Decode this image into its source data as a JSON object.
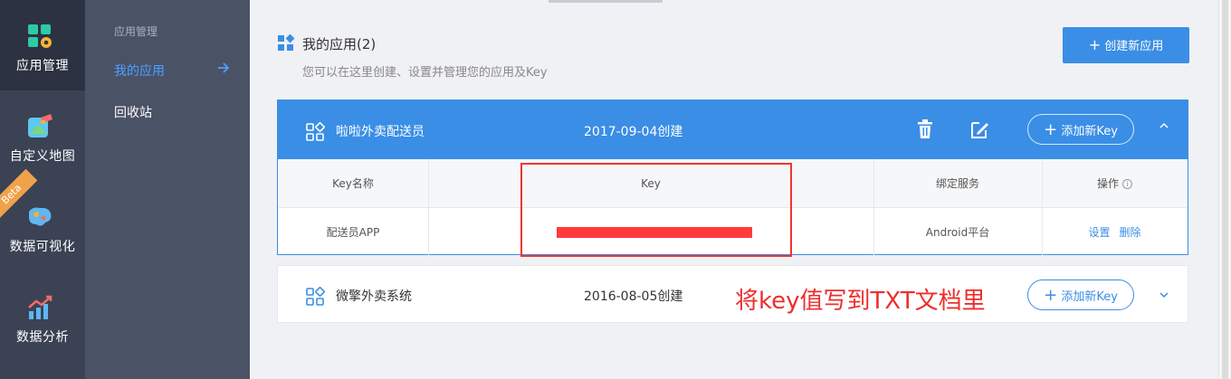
{
  "rail": {
    "items": [
      {
        "label": "应用管理",
        "icon": "app-manage-icon",
        "active": true
      },
      {
        "label": "自定义地图",
        "icon": "custom-map-icon"
      },
      {
        "label": "数据可视化",
        "icon": "data-visualization-icon",
        "badge": "Beta"
      },
      {
        "label": "数据分析",
        "icon": "data-analysis-icon"
      }
    ]
  },
  "subnav": {
    "heading": "应用管理",
    "items": [
      {
        "label": "我的应用",
        "active": true
      },
      {
        "label": "回收站"
      }
    ]
  },
  "page": {
    "title": "我的应用(2)",
    "subtitle": "您可以在这里创建、设置并管理您的应用及Key",
    "create_button": "创建新应用"
  },
  "apps": [
    {
      "name": "啦啦外卖配送员",
      "created": "2017-09-04创建",
      "add_key": "添加新Key",
      "expanded": true,
      "table": {
        "headers": [
          "Key名称",
          "Key",
          "绑定服务",
          "操作"
        ],
        "rows": [
          {
            "key_name": "配送员APP",
            "key": "",
            "service": "Android平台",
            "actions": [
              "设置",
              "删除"
            ]
          }
        ]
      }
    },
    {
      "name": "微擎外卖系统",
      "created": "2016-08-05创建",
      "add_key": "添加新Key",
      "expanded": false
    }
  ],
  "annotation": "将key值写到TXT文档里",
  "colors": {
    "accent": "#3a8ee6",
    "rail_bg": "#3b4254",
    "subnav_bg": "#4a5266",
    "annotation": "#ee2d2d",
    "beta_badge": "#f0a24a"
  }
}
